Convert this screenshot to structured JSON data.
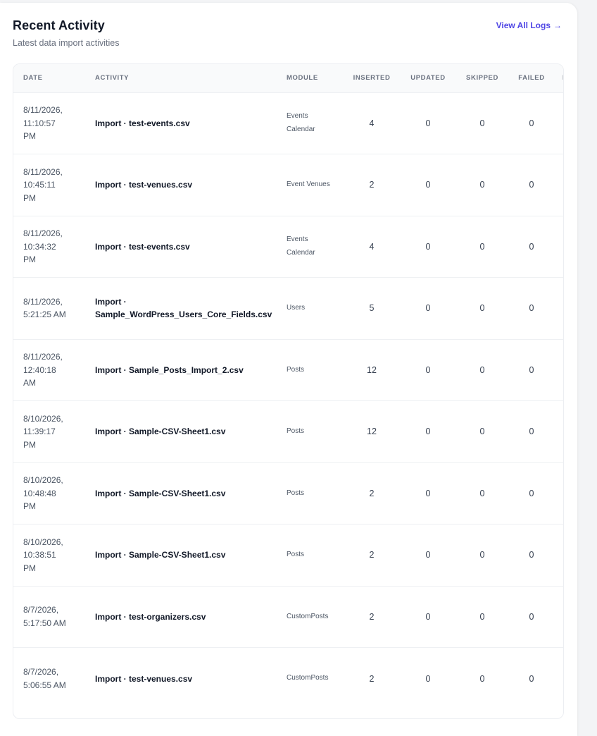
{
  "header": {
    "title": "Recent Activity",
    "subtitle": "Latest data import activities",
    "view_all_label": "View All Logs",
    "view_all_icon": "arrow-right-icon"
  },
  "colors": {
    "accent": "#4f46e5",
    "card_bg": "#ffffff",
    "page_bg": "#f3f4f6",
    "header_row_bg": "#f9fafb"
  },
  "table": {
    "columns": {
      "date": "DATE",
      "activity": "ACTIVITY",
      "module": "MODULE",
      "inserted": "INSERTED",
      "updated": "UPDATED",
      "skipped": "SKIPPED",
      "failed": "FAILED",
      "re": "RE"
    },
    "rows": [
      {
        "date": "8/11/2026, 11:10:57 PM",
        "activity": "Import · test-events.csv",
        "module": "Events Calendar",
        "inserted": "4",
        "updated": "0",
        "skipped": "0",
        "failed": "0"
      },
      {
        "date": "8/11/2026, 10:45:11 PM",
        "activity": "Import · test-venues.csv",
        "module": "Event Venues",
        "inserted": "2",
        "updated": "0",
        "skipped": "0",
        "failed": "0"
      },
      {
        "date": "8/11/2026, 10:34:32 PM",
        "activity": "Import · test-events.csv",
        "module": "Events Calendar",
        "inserted": "4",
        "updated": "0",
        "skipped": "0",
        "failed": "0"
      },
      {
        "date": "8/11/2026, 5:21:25 AM",
        "activity": "Import · Sample_WordPress_Users_Core_Fields.csv",
        "module": "Users",
        "inserted": "5",
        "updated": "0",
        "skipped": "0",
        "failed": "0"
      },
      {
        "date": "8/11/2026, 12:40:18 AM",
        "activity": "Import · Sample_Posts_Import_2.csv",
        "module": "Posts",
        "inserted": "12",
        "updated": "0",
        "skipped": "0",
        "failed": "0"
      },
      {
        "date": "8/10/2026, 11:39:17 PM",
        "activity": "Import · Sample-CSV-Sheet1.csv",
        "module": "Posts",
        "inserted": "12",
        "updated": "0",
        "skipped": "0",
        "failed": "0"
      },
      {
        "date": "8/10/2026, 10:48:48 PM",
        "activity": "Import · Sample-CSV-Sheet1.csv",
        "module": "Posts",
        "inserted": "2",
        "updated": "0",
        "skipped": "0",
        "failed": "0"
      },
      {
        "date": "8/10/2026, 10:38:51 PM",
        "activity": "Import · Sample-CSV-Sheet1.csv",
        "module": "Posts",
        "inserted": "2",
        "updated": "0",
        "skipped": "0",
        "failed": "0"
      },
      {
        "date": "8/7/2026, 5:17:50 AM",
        "activity": "Import · test-organizers.csv",
        "module": "CustomPosts",
        "inserted": "2",
        "updated": "0",
        "skipped": "0",
        "failed": "0"
      },
      {
        "date": "8/7/2026, 5:06:55 AM",
        "activity": "Import · test-venues.csv",
        "module": "CustomPosts",
        "inserted": "2",
        "updated": "0",
        "skipped": "0",
        "failed": "0"
      }
    ]
  }
}
